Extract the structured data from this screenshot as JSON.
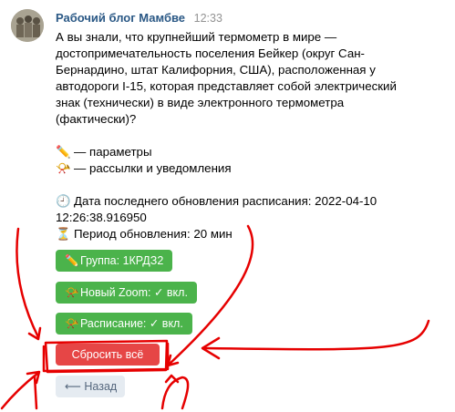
{
  "post": {
    "author": "Рабочий блог Мамбве",
    "time": "12:33",
    "text_lines": [
      "А вы знали, что крупнейший термометр в мире —",
      "достопримечательность поселения Бейкер (округ Сан-",
      "Бернардино, штат Калифорния, США), расположенная у",
      "автодороги I-15, которая представляет собой электрический",
      "знак (технически) в виде электронного термометра",
      "(фактически)?"
    ],
    "legend": [
      {
        "icon": "pencil-icon",
        "glyph": "✏️",
        "label": "— параметры"
      },
      {
        "icon": "horn-icon",
        "glyph": "📯",
        "label": "— рассылки и уведомления"
      }
    ],
    "update": {
      "clock_glyph": "🕘",
      "updated_line1": "Дата последнего обновления расписания: 2022-04-10",
      "updated_line2": "12:26:38.916950",
      "hourglass_glyph": "⏳",
      "period": "Период обновления: 20 мин"
    }
  },
  "buttons": {
    "group": {
      "glyph": "✏️",
      "label": "Группа: 1КРДЗ2"
    },
    "zoom": {
      "glyph": "📯",
      "label": "Новый Zoom: ✓ вкл."
    },
    "schedule": {
      "glyph": "📯",
      "label": "Расписание: ✓ вкл."
    },
    "reset": {
      "label": "Сбросить всё"
    },
    "back": {
      "label": "⟵ Назад"
    }
  },
  "colors": {
    "author": "#2a5885",
    "green_button": "#4bb34b",
    "red_button": "#e64646",
    "gray_button": "#e5ebf1",
    "annotation_ink": "#e60000"
  }
}
